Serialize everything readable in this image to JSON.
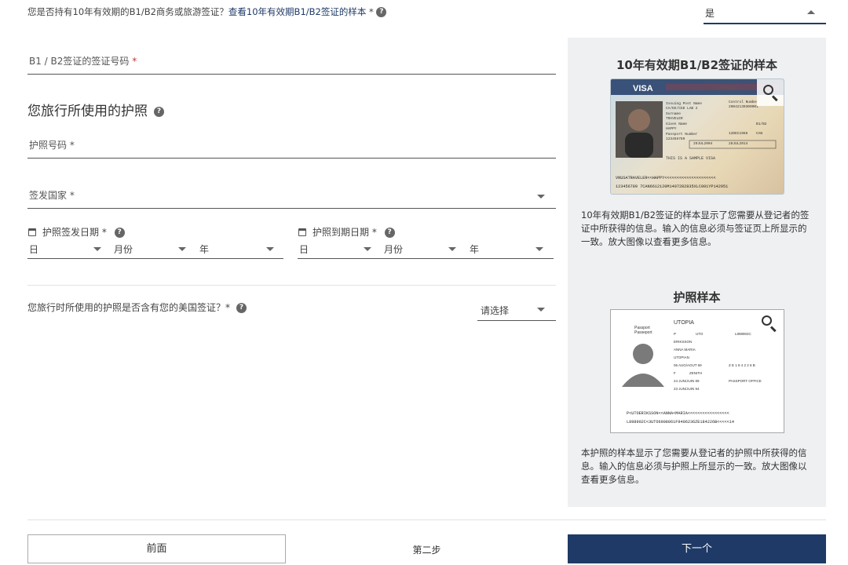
{
  "top_question": {
    "text": "您是否持有10年有效期的B1/B2商务或旅游签证？",
    "link": "查看10年有效期B1/B2签证的样本",
    "required": "*",
    "select_value": "是"
  },
  "visa_number": {
    "label": "B1 / B2签证的签证号码",
    "required": "*"
  },
  "passport_section": {
    "title": "您旅行所使用的护照"
  },
  "passport_number": {
    "label": "护照号码 *"
  },
  "issuing_country": {
    "label": "签发国家 *"
  },
  "issue_date": {
    "label": "护照签发日期 *",
    "day": "日",
    "month": "月份",
    "year": "年"
  },
  "expiry_date": {
    "label": "护照到期日期 *",
    "day": "日",
    "month": "月份",
    "year": "年"
  },
  "us_visa_question": {
    "text": "您旅行时所使用的护照是否含有您的美国签证？*",
    "select_value": "请选择"
  },
  "side_panel": {
    "visa_title": "10年有效期B1/B2签证的样本",
    "visa_text": "10年有效期B1/B2签证的样本显示了您需要从登记者的签证中所获得的信息。输入的信息必须与签证页上所显示的一致。放大图像以查看更多信息。",
    "passport_title": "护照样本",
    "passport_text": "本护照的样本显示了您需要从登记者的护照中所获得的信息。输入的信息必须与护照上所显示的一致。放大图像以查看更多信息。",
    "visa_image": {
      "header": "VISA",
      "sample_note": "THIS IS A SAMPLE VISA",
      "mrz1": "VNUSATRAVELER<<HAPPY<<<<<<<<<<<<<<<<<<<<<",
      "mrz2": "123456789 7CAN6612120M1407282835XLC001YP142951",
      "fields": [
        "Issuing Post Name",
        "CA/EE/CGD LAB 2",
        "Surname",
        "TRAVELER",
        "Given Name",
        "HAPPY",
        "Passport Number",
        "123456789",
        "29JUL2004",
        "28JUL2014",
        "12DEC1966",
        "CAN",
        "B1/B2",
        "Control Number",
        "20042130300001"
      ],
      "photo_alt": "visa holder photo"
    },
    "passport_image": {
      "country": "UTOPIA",
      "doc_type": "Passport",
      "doc_type2": "Passeport",
      "doc_code": "P",
      "country_code": "UTO",
      "number": "L898902C",
      "surname": "ERIKSSON",
      "given": "ANNA MARIA",
      "nationality": "UTOPIAN",
      "dob": "06 AUG/AOUT 69",
      "sex": "F",
      "birthplace": "ZENITH",
      "issue": "24 JUN/JUIN 89",
      "expiry": "23 JUN/JUIN 94",
      "authority": "PASSPORT OFFICE",
      "personal_no": "Z E 1 8 4 2 2 6 B",
      "mrz1": "P<UTOERIKSSON<<ANNA<MARIA<<<<<<<<<<<<<<<<<",
      "mrz2": "L898902C<3UTO6908061F9406236ZE184226B<<<<<14"
    }
  },
  "footer": {
    "prev": "前面",
    "step": "第二步",
    "next": "下一个"
  },
  "colors": {
    "primary": "#1f3a66",
    "panel": "#eef0f2",
    "line": "#555555"
  }
}
